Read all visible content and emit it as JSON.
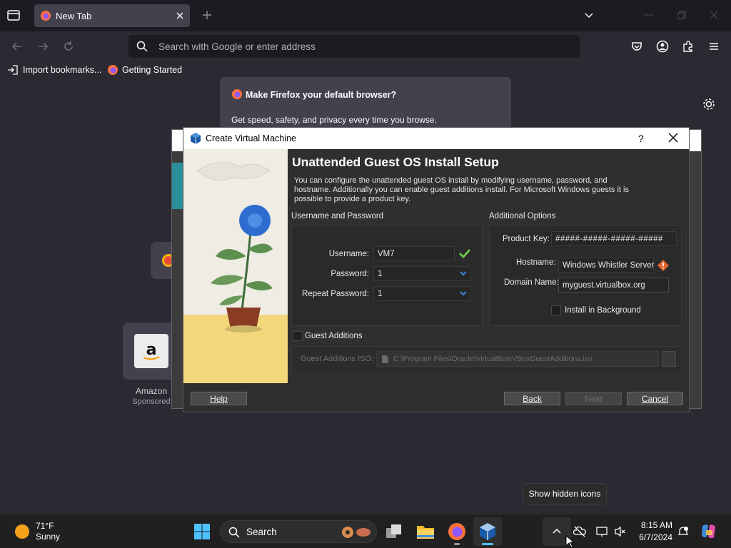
{
  "browser": {
    "tab_title": "New Tab",
    "url_placeholder": "Search with Google or enter address",
    "bookmarks": [
      "Import bookmarks...",
      "Getting Started"
    ],
    "notification": {
      "title": "Make Firefox your default browser?",
      "body": "Get speed, safety, and privacy every time you browse."
    },
    "shortcut": {
      "label": "Amazon",
      "sublabel": "Sponsored"
    }
  },
  "dialog": {
    "title": "Create Virtual Machine",
    "help_glyph": "?",
    "heading": "Unattended Guest OS Install Setup",
    "description": "You can configure the unattended guest OS install by modifying username, password, and hostname. Additionally you can enable guest additions install. For Microsoft Windows guests it is possible to provide a product key.",
    "user_group": {
      "title": "Username and Password",
      "username_label": "Username:",
      "username": "VM7",
      "password_label": "Password:",
      "password": "1",
      "repeat_label": "Repeat Password:",
      "repeat": "1"
    },
    "options_group": {
      "title": "Additional Options",
      "product_key_label": "Product Key:",
      "product_key": "#####-#####-#####-#####",
      "hostname_label": "Hostname:",
      "hostname": "Windows Whistler Server",
      "domain_label": "Domain Name:",
      "domain": "myguest.virtualbox.org",
      "install_bg_label": "Install in Background"
    },
    "guest_additions": {
      "label": "Guest Additions",
      "iso_label": "Guest Additions ISO:",
      "iso_path": "C:\\Program Files\\Oracle\\VirtualBox\\VBoxGuestAdditions.iso"
    },
    "buttons": {
      "help": "Help",
      "back": "Back",
      "next": "Next",
      "cancel": "Cancel"
    }
  },
  "taskbar": {
    "weather_temp": "71°F",
    "weather_desc": "Sunny",
    "search_label": "Search",
    "time": "8:15 AM",
    "date": "6/7/2024",
    "tooltip": "Show hidden icons"
  }
}
